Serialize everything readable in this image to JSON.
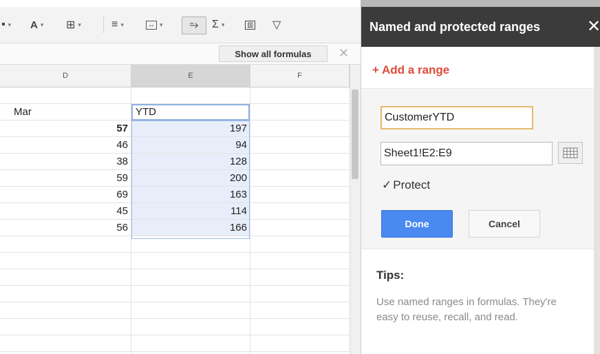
{
  "toolbar": {
    "show_all_formulas": "Show all formulas",
    "close_glyph": "✕",
    "icons": [
      "text-color-icon",
      "borders-icon",
      "align-icon",
      "merge-cells-icon",
      "wrap-text-icon",
      "functions-icon",
      "insert-chart-icon",
      "filter-icon"
    ]
  },
  "columns": [
    "D",
    "E",
    "F"
  ],
  "sheet": {
    "label_d": "Mar",
    "label_e": "YTD",
    "rows": [
      {
        "d": "57",
        "e": "197"
      },
      {
        "d": "46",
        "e": "94"
      },
      {
        "d": "38",
        "e": "128"
      },
      {
        "d": "59",
        "e": "200"
      },
      {
        "d": "69",
        "e": "163"
      },
      {
        "d": "45",
        "e": "114"
      },
      {
        "d": "56",
        "e": "166"
      }
    ]
  },
  "panel": {
    "title": "Named and protected ranges",
    "close_glyph": "✕",
    "add_range": "+ Add a range",
    "range_name_value": "CustomerYTD",
    "range_ref_value": "Sheet1!E2:E9",
    "protect_label": "Protect",
    "protect_checked": true,
    "done_label": "Done",
    "cancel_label": "Cancel",
    "tips_title": "Tips:",
    "tips_text": "Use named ranges in formulas. They're easy to reuse, recall, and read."
  },
  "colors": {
    "accent_add": "#dd4b39",
    "done_button": "#4a89f0",
    "panel_header": "#3b3b3b",
    "selection": "#e8eef9"
  }
}
